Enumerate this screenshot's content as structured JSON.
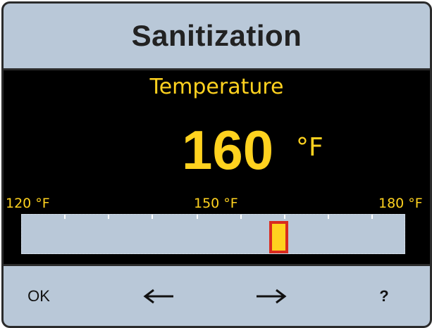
{
  "header": {
    "title": "Sanitization"
  },
  "parameter": {
    "label": "Temperature",
    "value": "160",
    "unit": "°F"
  },
  "scale": {
    "min_label": "120 °F",
    "mid_label": "150 °F",
    "max_label": "180 °F",
    "min": 120,
    "max": 180,
    "current": 160
  },
  "softkeys": {
    "ok_label": "OK",
    "left_icon": "arrow-left-icon",
    "right_icon": "arrow-right-icon",
    "help_label": "?"
  },
  "colors": {
    "header_bg": "#b9c8d8",
    "screen_bg": "#000000",
    "value_text": "#ffd21f",
    "marker_fill": "#ffd21f",
    "marker_border": "#d92b1f"
  }
}
